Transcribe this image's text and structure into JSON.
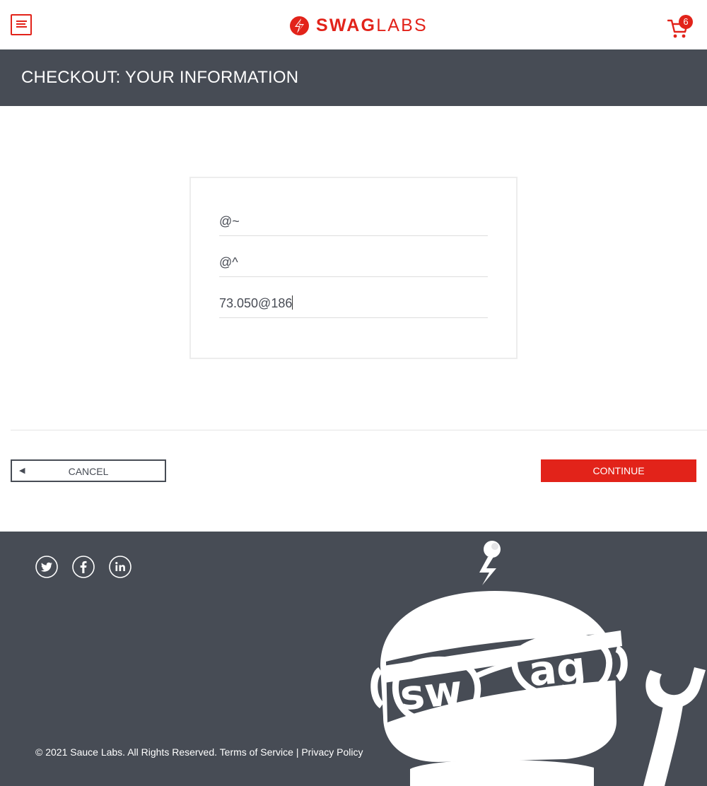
{
  "header": {
    "logo": {
      "bold": "SWAG",
      "light": "LABS"
    },
    "cart_count": "6"
  },
  "subheader": {
    "title": "CHECKOUT: YOUR INFORMATION"
  },
  "form": {
    "first_name": "@~",
    "last_name": "@^",
    "postal_code": "73.050@186"
  },
  "actions": {
    "cancel_label": "CANCEL",
    "continue_label": "CONTINUE"
  },
  "footer": {
    "copyright": "© 2021 Sauce Labs. All Rights Reserved.",
    "terms": "Terms of Service",
    "separator": "|",
    "privacy": "Privacy Policy",
    "robot_lettering": "swag"
  },
  "colors": {
    "brand": "#e2231a",
    "dark": "#474c55"
  }
}
